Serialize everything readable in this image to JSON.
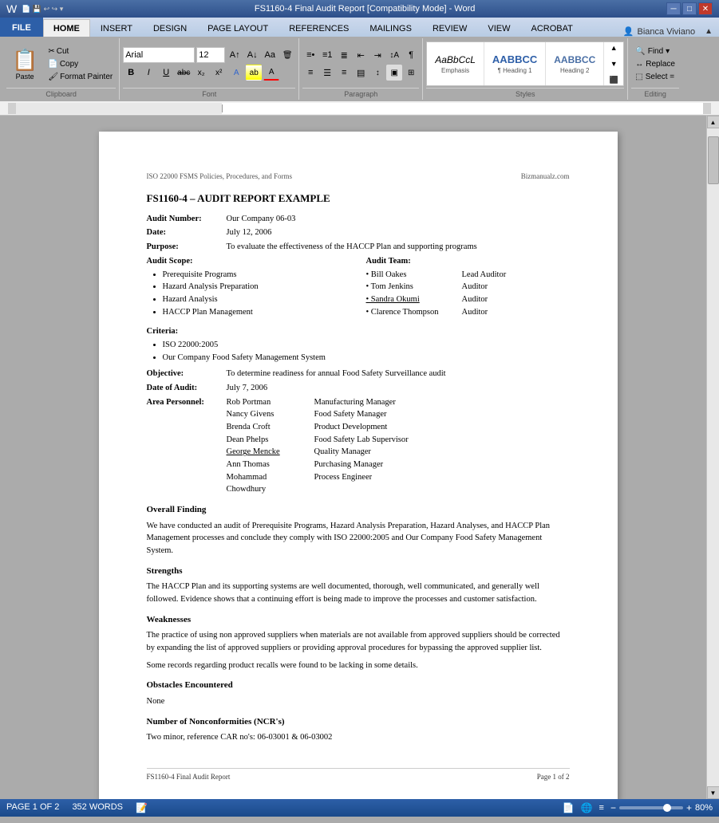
{
  "titleBar": {
    "title": "FS1160-4 Final Audit Report [Compatibility Mode] - Word",
    "minBtn": "─",
    "maxBtn": "□",
    "closeBtn": "✕"
  },
  "quickToolbar": {
    "save": "💾",
    "undo": "↩",
    "redo": "↪",
    "more": "▾"
  },
  "ribbon": {
    "tabs": [
      "FILE",
      "HOME",
      "INSERT",
      "DESIGN",
      "PAGE LAYOUT",
      "REFERENCES",
      "MAILINGS",
      "REVIEW",
      "VIEW",
      "ACROBAT"
    ],
    "activeTab": "HOME",
    "groups": {
      "clipboard": {
        "label": "Clipboard",
        "paste": "Paste",
        "cut": "Cut",
        "copy": "Copy",
        "formatPainter": "Format Painter"
      },
      "font": {
        "label": "Font",
        "fontName": "Arial",
        "fontSize": "12",
        "bold": "B",
        "italic": "I",
        "underline": "U",
        "strikethrough": "abc",
        "subscript": "x₂",
        "superscript": "x²"
      },
      "paragraph": {
        "label": "Paragraph"
      },
      "styles": {
        "label": "Styles",
        "items": [
          {
            "name": "Emphasis",
            "preview": "AaBbCcL",
            "italic": true
          },
          {
            "name": "Heading 1",
            "preview": "AABBCC",
            "heading": true
          },
          {
            "name": "Heading 2",
            "preview": "AABBCC",
            "heading2": true
          }
        ]
      },
      "editing": {
        "label": "Editing",
        "find": "Find",
        "replace": "Replace",
        "select": "Select ="
      }
    },
    "user": "Bianca Viviano"
  },
  "document": {
    "headerLeft": "ISO 22000 FSMS Policies, Procedures, and Forms",
    "headerRight": "Bizmanualz.com",
    "title": "FS1160-4 – AUDIT REPORT EXAMPLE",
    "auditNumber": {
      "label": "Audit Number:",
      "value": "Our Company 06-03"
    },
    "date": {
      "label": "Date:",
      "value": "July 12, 2006"
    },
    "purpose": {
      "label": "Purpose:",
      "value": "To evaluate the effectiveness of the HACCP Plan and supporting programs"
    },
    "auditScope": {
      "label": "Audit Scope:",
      "items": [
        "Prerequisite Programs",
        "Hazard Analysis Preparation",
        "Hazard Analysis",
        "HACCP Plan Management"
      ]
    },
    "auditTeam": {
      "label": "Audit Team:",
      "members": [
        {
          "name": "Bill Oakes",
          "role": "Lead Auditor"
        },
        {
          "name": "Tom Jenkins",
          "role": "Auditor"
        },
        {
          "name": "Sandra Okumi",
          "role": "Auditor",
          "underline": true
        },
        {
          "name": "Clarence Thompson",
          "role": "Auditor"
        }
      ]
    },
    "criteria": {
      "label": "Criteria:",
      "items": [
        "ISO 22000:2005",
        "Our Company Food Safety Management System"
      ]
    },
    "objective": {
      "label": "Objective:",
      "value": "To determine readiness for annual Food Safety Surveillance audit"
    },
    "dateOfAudit": {
      "label": "Date of Audit:",
      "value": "July 7, 2006"
    },
    "areaPersonnel": {
      "label": "Area Personnel:",
      "people": [
        {
          "name": "Rob Portman",
          "title": "Manufacturing Manager"
        },
        {
          "name": "Nancy Givens",
          "title": "Food Safety Manager"
        },
        {
          "name": "Brenda Croft",
          "title": "Product Development"
        },
        {
          "name": "Dean Phelps",
          "title": "Food Safety Lab Supervisor"
        },
        {
          "name": "George Mencke",
          "title": "Quality Manager",
          "underline": true
        },
        {
          "name": "Ann Thomas",
          "title": "Purchasing Manager"
        },
        {
          "name": "Mohammad Chowdhury",
          "title": "Process Engineer"
        }
      ]
    },
    "sections": [
      {
        "heading": "Overall Finding",
        "text": "We have conducted an audit of Prerequisite Programs, Hazard Analysis Preparation, Hazard Analyses, and HACCP Plan Management processes and conclude they comply with ISO 22000:2005 and Our Company Food Safety Management System."
      },
      {
        "heading": "Strengths",
        "text": "The HACCP Plan and its supporting systems are well documented, thorough, well communicated, and generally well followed. Evidence shows that a continuing effort is being made to improve the processes and customer satisfaction."
      },
      {
        "heading": "Weaknesses",
        "text1": "The practice of using non approved suppliers when materials are not available from approved suppliers should be corrected by expanding the list of approved suppliers or providing approval procedures for bypassing the approved supplier list.",
        "text2": "Some records regarding product recalls were found to be lacking in some details."
      },
      {
        "heading": "Obstacles Encountered",
        "text": "None"
      },
      {
        "heading": "Number of Nonconformities (NCR's)",
        "text": "Two minor, reference CAR no's: 06-03001 & 06-03002"
      }
    ],
    "footerLeft": "FS1160-4 Final Audit Report",
    "footerRight": "Page 1 of 2"
  },
  "statusBar": {
    "pageInfo": "PAGE 1 OF 2",
    "wordCount": "352 WORDS",
    "zoom": "80%",
    "zoomPercent": 80
  }
}
